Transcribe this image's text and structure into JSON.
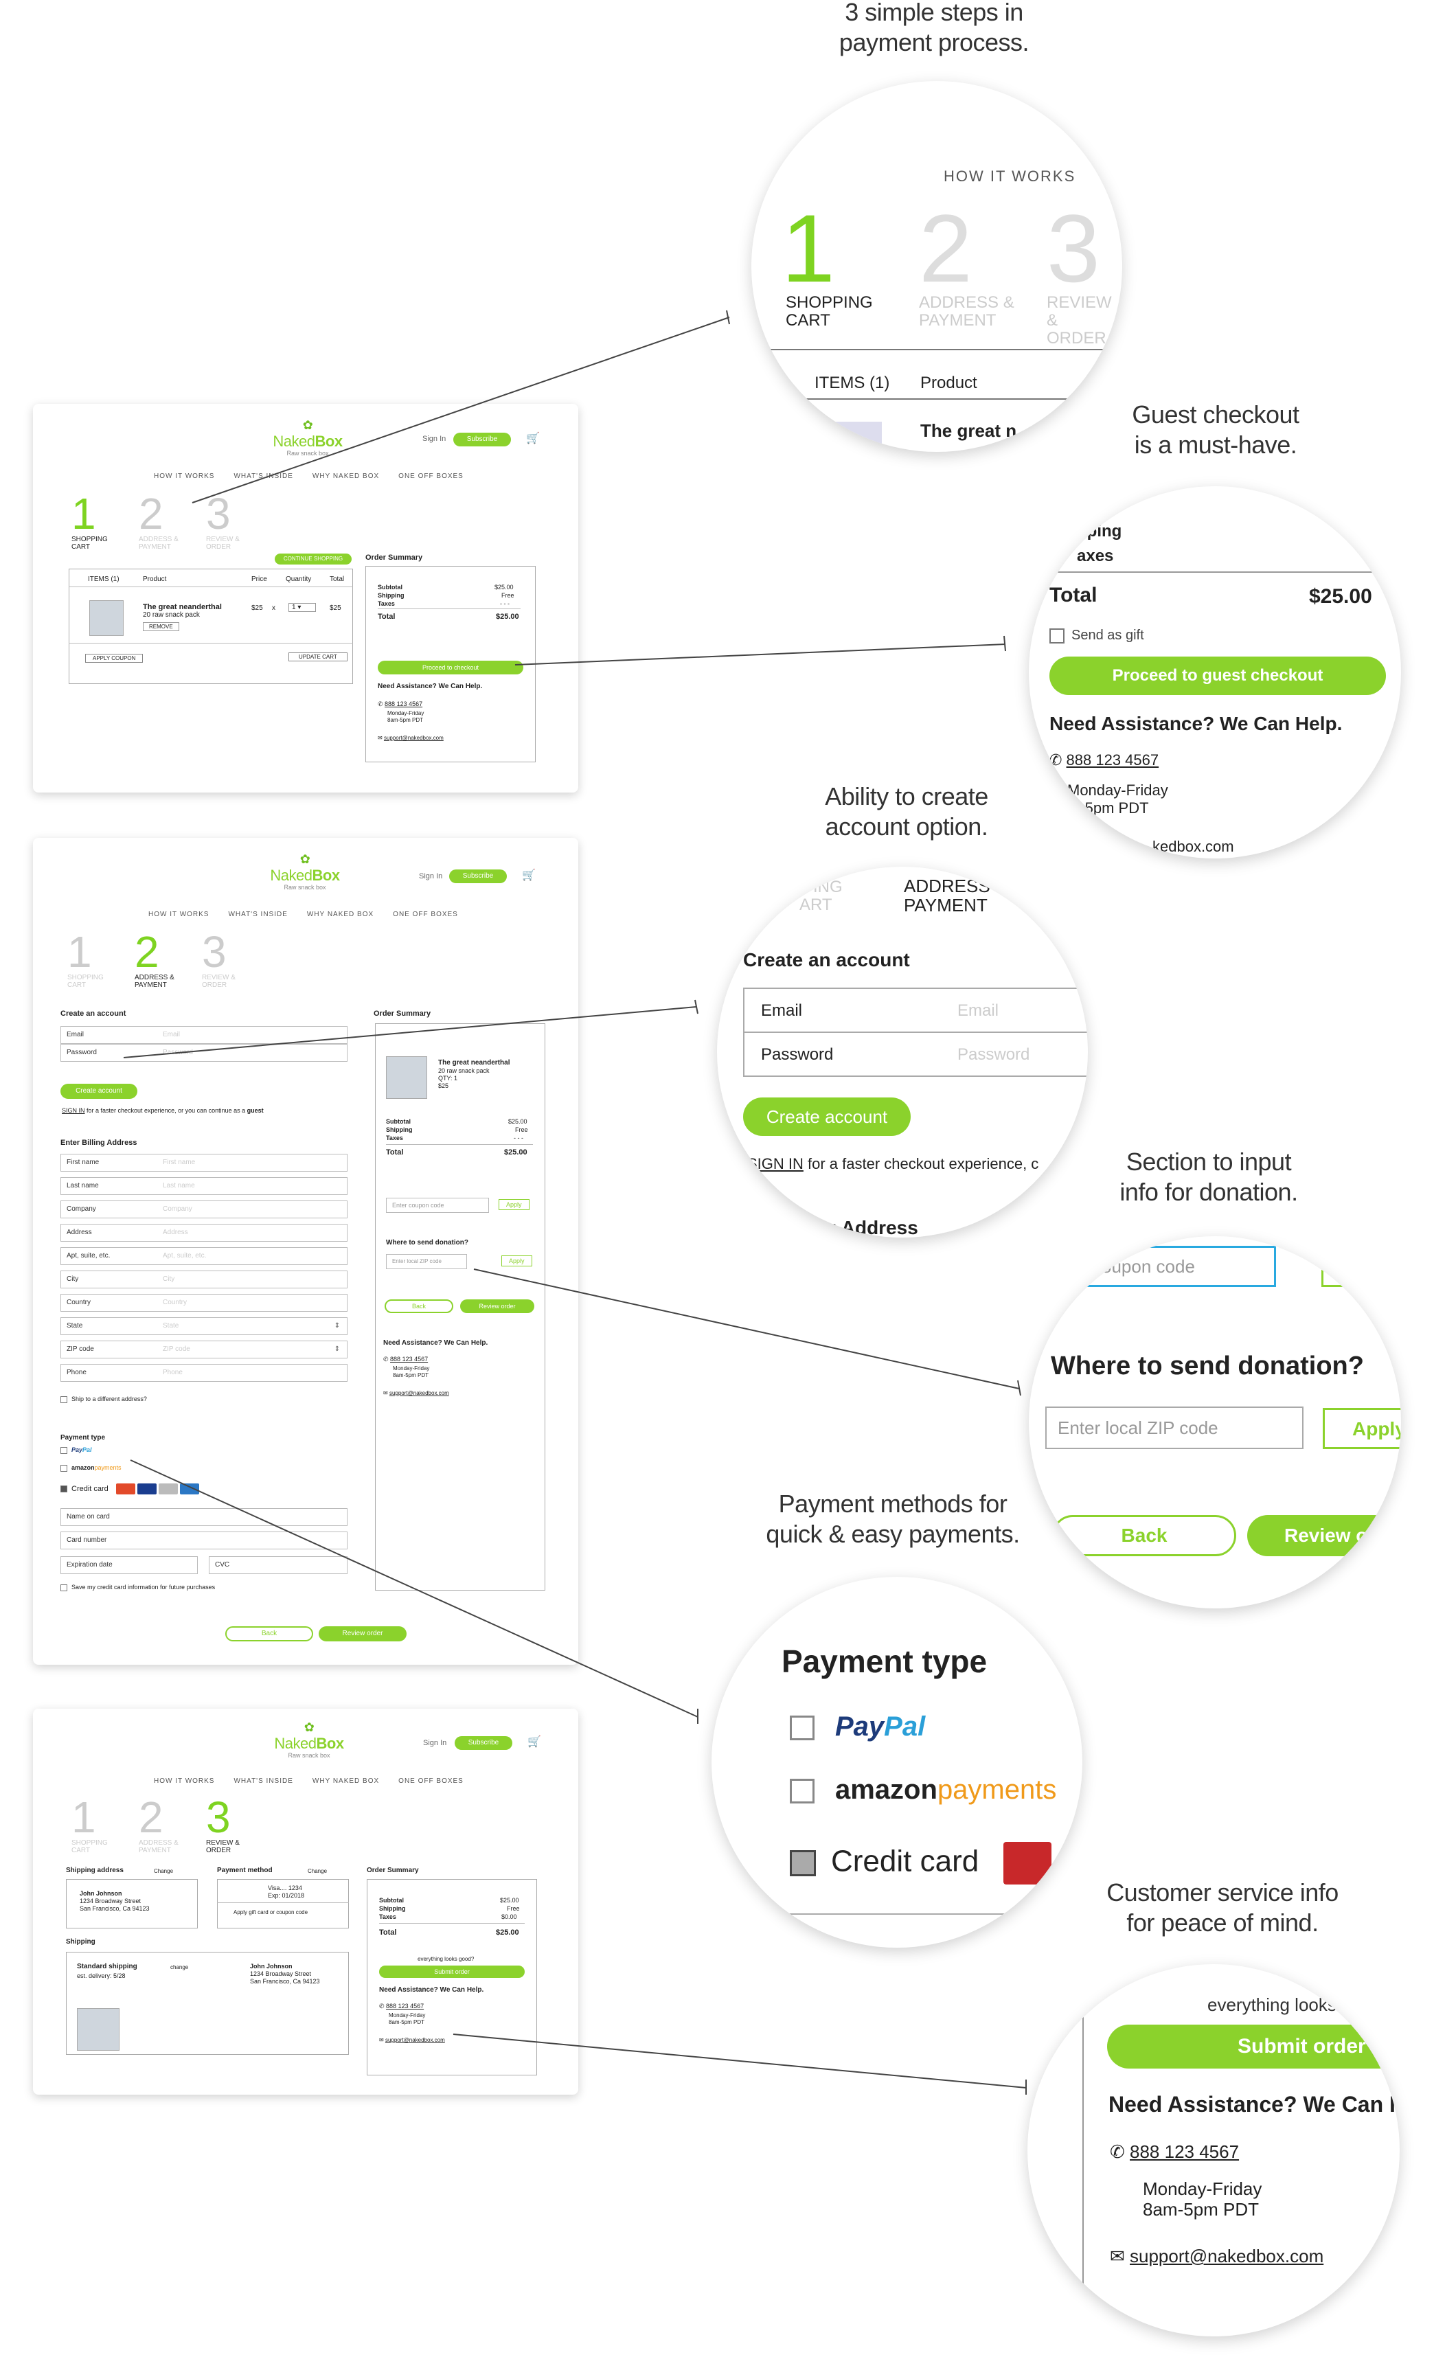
{
  "captions": {
    "steps": "3 simple steps in\npayment process.",
    "guest": "Guest checkout\nis a must-have.",
    "account": "Ability to create\naccount option.",
    "donation": "Section to input\ninfo for donation.",
    "payment": "Payment methods for\nquick & easy payments.",
    "service": "Customer service info\nfor peace of mind."
  },
  "brand": {
    "name_light": "Naked",
    "name_bold": "Box",
    "tagline": "Raw snack box",
    "accent": "#8bd22c"
  },
  "header": {
    "sign_in": "Sign In",
    "subscribe": "Subscribe",
    "cart_icon": "cart-icon",
    "cart_count": "1"
  },
  "nav": [
    "HOW IT WORKS",
    "WHAT'S INSIDE",
    "WHY NAKED BOX",
    "ONE OFF BOXES"
  ],
  "steps": [
    {
      "num": "1",
      "label": "SHOPPING\nCART"
    },
    {
      "num": "2",
      "label": "ADDRESS &\nPAYMENT"
    },
    {
      "num": "3",
      "label": "REVIEW &\nORDER"
    }
  ],
  "cart": {
    "continue": "CONTINUE SHOPPING",
    "headers": [
      "ITEMS (1)",
      "Product",
      "Price",
      "Quantity",
      "Total"
    ],
    "product_name": "The great neanderthal",
    "product_desc": "20 raw snack pack",
    "price": "$25",
    "times": "x",
    "qty": "1",
    "total": "$25",
    "remove": "REMOVE",
    "apply_coupon": "APPLY COUPON",
    "update_cart": "UPDATE CART"
  },
  "summary": {
    "title": "Order Summary",
    "subtotal_label": "Subtotal",
    "subtotal": "$25.00",
    "shipping_label": "Shipping",
    "shipping": "Free",
    "shipping_zero": "$0.00",
    "taxes_label": "Taxes",
    "taxes": "- - -",
    "total_label": "Total",
    "total": "$25.00",
    "proceed": "Proceed to checkout",
    "qty_line": "QTY: 1",
    "price_line": "$25",
    "looks_good": "everything looks good?",
    "submit": "Submit order"
  },
  "help": {
    "title": "Need Assistance? We Can Help.",
    "phone": "888 123 4567",
    "hours1": "Monday-Friday",
    "hours2": "8am-5pm PDT",
    "email": "support@nakedbox.com"
  },
  "account": {
    "title": "Create an account",
    "email_label": "Email",
    "email_ph": "Email",
    "password_label": "Password",
    "password_ph": "Password",
    "create": "Create account",
    "signin_link": "SIGN IN",
    "signin_text": " for a faster checkout experience, or you can continue as a ",
    "guest": "guest"
  },
  "billing": {
    "title": "Enter Billing Address",
    "fields": [
      {
        "label": "First name",
        "ph": "First name"
      },
      {
        "label": "Last name",
        "ph": "Last name"
      },
      {
        "label": "Company",
        "ph": "Company"
      },
      {
        "label": "Address",
        "ph": "Address"
      },
      {
        "label": "Apt, suite, etc.",
        "ph": "Apt, suite, etc."
      },
      {
        "label": "City",
        "ph": "City"
      },
      {
        "label": "Country",
        "ph": "Country"
      },
      {
        "label": "State",
        "ph": "State"
      },
      {
        "label": "ZIP code",
        "ph": "ZIP code"
      },
      {
        "label": "Phone",
        "ph": "Phone"
      }
    ],
    "ship_diff": "Ship to a different address?"
  },
  "payment": {
    "title": "Payment type",
    "paypal_pay": "Pay",
    "paypal_pal": "Pal",
    "amazon": "amazon",
    "amazon_payments": "payments",
    "credit": "Credit card",
    "name_on_card": "Name on card",
    "card_number": "Card number",
    "expiration": "Expiration date",
    "cvc": "CVC",
    "save": "Save my credit card information for future purchases",
    "back": "Back",
    "review": "Review order"
  },
  "coupon": {
    "placeholder": "Enter coupon code",
    "apply": "Apply"
  },
  "donation": {
    "title": "Where to send donation?",
    "placeholder": "Enter local ZIP code",
    "apply": "Apply"
  },
  "review": {
    "ship_addr_title": "Shipping address",
    "change": "Change",
    "change_lower": "change",
    "name": "John Johnson",
    "street": "1234 Broadway Street",
    "city": "San Francisco, Ca 94123",
    "pm_title": "Payment method",
    "visa": "Visa.... 1234",
    "exp": "Exp: 01/2018",
    "gift": "Apply gift card or coupon code",
    "shipping_title": "Shipping",
    "std": "Standard shipping",
    "est": "est. delivery: 5/28"
  },
  "zoom_guest": {
    "shipping_partial": "pping",
    "taxes_partial": "axes",
    "send_gift": "Send as gift",
    "proceed_guest": "Proceed to guest checkout",
    "email_partial": "kedbox.com",
    "hours_partial": "m-5pm PDT"
  },
  "zoom_steps": {
    "header": "HOW IT WORKS",
    "items": "ITEMS (1)",
    "product": "Product",
    "product_partial": "The great n"
  },
  "zoom_account": {
    "step1_partial": "ING",
    "step1b_partial": "ART",
    "address_partial": "z Address",
    "signin_rest": " for a faster checkout experience, c"
  },
  "zoom_donation": {
    "coupon_partial": "coupon code",
    "apply_partial": "Apply",
    "review_partial": "Review o"
  },
  "zoom_service": {
    "looks_partial": "everything looks",
    "submit_partial": "Submit order",
    "title_partial": "Need Assistance? We Can H"
  }
}
